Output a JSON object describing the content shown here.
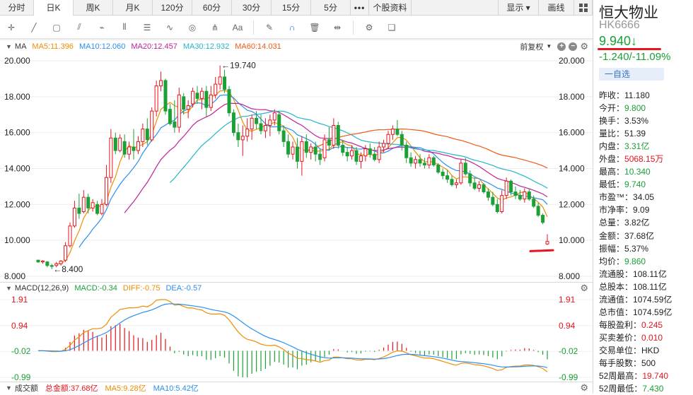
{
  "tabs": [
    {
      "label": "分时",
      "width": 48
    },
    {
      "label": "日K",
      "width": 56,
      "active": true
    },
    {
      "label": "周K",
      "width": 56
    },
    {
      "label": "月K",
      "width": 56
    },
    {
      "label": "120分",
      "width": 56
    },
    {
      "label": "60分",
      "width": 56
    },
    {
      "label": "30分",
      "width": 56
    },
    {
      "label": "15分",
      "width": 56
    },
    {
      "label": "5分",
      "width": 56
    },
    {
      "label": "•••",
      "width": 26,
      "dots": true
    },
    {
      "label": "个股资料",
      "width": 60
    }
  ],
  "tab_right": {
    "display": "显示",
    "draw": "画线"
  },
  "toolbar_icons": [
    "crosshair-icon",
    "line-icon",
    "rect-icon",
    "fan-icon",
    "path-icon",
    "parallel-icon",
    "fib-icon",
    "wave-icon",
    "circle-icon",
    "pitchfork-icon",
    "text-icon",
    "pen-icon",
    "magnet-icon",
    "trash-icon",
    "split-icon",
    "settings-icon",
    "layers-icon"
  ],
  "ma_bar": {
    "title": "MA",
    "items": [
      {
        "label": "MA5:11.396",
        "color": "#f08c00"
      },
      {
        "label": "MA10:12.060",
        "color": "#2a8ff0"
      },
      {
        "label": "MA20:12.457",
        "color": "#c0209b"
      },
      {
        "label": "MA30:12.932",
        "color": "#25b5c8"
      },
      {
        "label": "MA60:14.031",
        "color": "#f05a12"
      }
    ],
    "adjust": "前复权"
  },
  "macd_bar": {
    "title": "MACD(12,26,9)",
    "items": [
      {
        "label": "MACD:-0.34",
        "color": "#1aa035"
      },
      {
        "label": "DIFF:-0.75",
        "color": "#f08c00"
      },
      {
        "label": "DEA:-0.57",
        "color": "#2a8ff0"
      }
    ]
  },
  "vol_bar": {
    "title": "成交额",
    "items": [
      {
        "label": "总金额:37.68亿",
        "color": "#e8141e"
      },
      {
        "label": "MA5:9.28亿",
        "color": "#f08c00"
      },
      {
        "label": "MA10:5.42亿",
        "color": "#2a8ff0"
      }
    ]
  },
  "chart_data": {
    "type": "candlestick",
    "price_axis": {
      "ticks": [
        "20.000",
        "18.000",
        "16.000",
        "14.000",
        "12.000",
        "10.000",
        "8.000"
      ],
      "ylim": [
        8.0,
        20.0
      ]
    },
    "annotations": {
      "high": "←19.740",
      "low": "←8.400"
    },
    "macd_axis": {
      "ticks": [
        "1.91",
        "0.94",
        "-0.02",
        "-0.99"
      ],
      "tick_colors": [
        "#e8141e",
        "#e8141e",
        "#1aa035",
        "#1aa035"
      ],
      "ylim": [
        -0.99,
        1.91
      ]
    },
    "up_color": "#e8141e",
    "down_color": "#1aa035",
    "candles_ohlc": [
      [
        8.9,
        8.9,
        8.75,
        8.8
      ],
      [
        8.8,
        8.9,
        8.7,
        8.85
      ],
      [
        8.8,
        8.85,
        8.5,
        8.6
      ],
      [
        8.6,
        8.7,
        8.4,
        8.55
      ],
      [
        8.6,
        8.8,
        8.5,
        8.7
      ],
      [
        8.7,
        8.9,
        8.6,
        8.85
      ],
      [
        8.9,
        9.9,
        8.8,
        9.7
      ],
      [
        9.7,
        11.0,
        9.6,
        10.8
      ],
      [
        10.8,
        12.2,
        10.7,
        11.8
      ],
      [
        11.8,
        12.6,
        11.2,
        11.5
      ],
      [
        11.6,
        12.8,
        11.5,
        12.4
      ],
      [
        12.4,
        12.6,
        11.5,
        11.8
      ],
      [
        11.8,
        12.3,
        11.6,
        12.1
      ],
      [
        12.0,
        12.2,
        11.4,
        11.5
      ],
      [
        11.5,
        12.3,
        11.4,
        12.0
      ],
      [
        12.0,
        14.2,
        11.9,
        13.5
      ],
      [
        13.5,
        16.2,
        13.2,
        15.7
      ],
      [
        15.7,
        16.0,
        14.8,
        15.0
      ],
      [
        15.0,
        15.9,
        14.9,
        15.7
      ],
      [
        15.5,
        15.9,
        14.6,
        14.8
      ],
      [
        14.8,
        15.5,
        14.5,
        15.2
      ],
      [
        15.2,
        16.2,
        14.5,
        15.0
      ],
      [
        15.0,
        15.8,
        14.8,
        15.5
      ],
      [
        15.5,
        16.5,
        15.2,
        16.2
      ],
      [
        16.2,
        16.8,
        15.3,
        15.6
      ],
      [
        15.6,
        17.4,
        15.5,
        17.2
      ],
      [
        17.2,
        18.9,
        16.9,
        18.6
      ],
      [
        18.6,
        19.4,
        18.3,
        18.9
      ],
      [
        18.9,
        19.0,
        17.0,
        17.2
      ],
      [
        17.3,
        17.6,
        16.4,
        16.5
      ],
      [
        16.6,
        17.8,
        16.0,
        16.3
      ],
      [
        16.3,
        18.5,
        16.0,
        18.1
      ],
      [
        18.0,
        18.2,
        17.0,
        17.3
      ],
      [
        17.3,
        17.8,
        16.8,
        17.5
      ],
      [
        17.6,
        18.5,
        17.4,
        18.3
      ],
      [
        18.2,
        18.6,
        17.6,
        17.9
      ],
      [
        17.9,
        18.5,
        17.3,
        18.3
      ],
      [
        18.3,
        18.6,
        16.9,
        17.4
      ],
      [
        17.4,
        18.6,
        17.2,
        18.1
      ],
      [
        18.1,
        19.1,
        17.9,
        18.7
      ],
      [
        18.7,
        19.74,
        18.4,
        19.1
      ],
      [
        19.1,
        19.5,
        18.2,
        18.4
      ],
      [
        18.4,
        18.6,
        16.9,
        17.1
      ],
      [
        17.1,
        17.3,
        15.8,
        16.0
      ],
      [
        16.0,
        16.5,
        15.2,
        15.6
      ],
      [
        15.6,
        16.4,
        14.7,
        15.8
      ],
      [
        15.8,
        16.8,
        15.5,
        16.2
      ],
      [
        16.2,
        17.0,
        15.6,
        16.8
      ],
      [
        16.8,
        17.2,
        16.2,
        16.5
      ],
      [
        16.5,
        17.0,
        15.9,
        16.1
      ],
      [
        16.1,
        16.8,
        15.7,
        16.4
      ],
      [
        16.4,
        17.0,
        15.8,
        16.7
      ],
      [
        16.7,
        17.3,
        16.4,
        17.1
      ],
      [
        17.0,
        17.2,
        15.9,
        16.1
      ],
      [
        16.1,
        16.4,
        15.2,
        15.5
      ],
      [
        15.5,
        15.9,
        14.6,
        14.8
      ],
      [
        14.8,
        15.5,
        14.5,
        15.2
      ],
      [
        15.2,
        15.7,
        14.0,
        14.4
      ],
      [
        14.4,
        15.8,
        13.6,
        15.5
      ],
      [
        15.5,
        15.9,
        14.6,
        14.9
      ],
      [
        14.9,
        15.4,
        14.5,
        15.2
      ],
      [
        15.2,
        15.5,
        14.4,
        14.8
      ],
      [
        14.8,
        15.1,
        14.2,
        14.5
      ],
      [
        14.6,
        15.9,
        14.4,
        15.6
      ],
      [
        15.6,
        16.3,
        15.0,
        15.3
      ],
      [
        15.3,
        16.8,
        15.1,
        16.4
      ],
      [
        16.4,
        16.6,
        15.1,
        15.3
      ],
      [
        15.3,
        15.6,
        14.7,
        14.9
      ],
      [
        14.9,
        15.2,
        14.4,
        14.7
      ],
      [
        14.7,
        15.3,
        14.5,
        15.0
      ],
      [
        15.0,
        15.2,
        14.2,
        14.4
      ],
      [
        14.4,
        14.9,
        14.0,
        14.7
      ],
      [
        14.7,
        15.3,
        14.4,
        15.1
      ],
      [
        15.1,
        15.4,
        14.6,
        14.8
      ],
      [
        14.8,
        15.2,
        14.4,
        14.5
      ],
      [
        14.5,
        15.5,
        14.3,
        15.2
      ],
      [
        15.2,
        15.6,
        14.9,
        15.4
      ],
      [
        15.4,
        16.1,
        15.1,
        15.9
      ],
      [
        15.9,
        16.4,
        15.6,
        16.2
      ],
      [
        16.2,
        16.7,
        15.8,
        15.9
      ],
      [
        15.9,
        16.1,
        15.0,
        15.3
      ],
      [
        15.3,
        15.5,
        14.3,
        14.6
      ],
      [
        14.6,
        14.9,
        14.1,
        14.3
      ],
      [
        14.3,
        14.7,
        14.0,
        14.5
      ],
      [
        14.5,
        14.8,
        14.1,
        14.3
      ],
      [
        14.3,
        14.6,
        14.0,
        14.2
      ],
      [
        14.2,
        14.8,
        14.0,
        14.6
      ],
      [
        14.6,
        14.7,
        14.1,
        14.2
      ],
      [
        14.2,
        14.3,
        13.7,
        13.8
      ],
      [
        13.8,
        14.0,
        13.4,
        13.6
      ],
      [
        13.6,
        13.9,
        13.2,
        13.4
      ],
      [
        13.4,
        13.6,
        13.0,
        13.1
      ],
      [
        13.1,
        13.4,
        12.9,
        13.2
      ],
      [
        13.2,
        14.5,
        13.1,
        14.3
      ],
      [
        14.3,
        14.6,
        13.6,
        13.7
      ],
      [
        13.7,
        13.9,
        13.0,
        13.2
      ],
      [
        13.2,
        13.5,
        12.8,
        12.9
      ],
      [
        12.9,
        13.3,
        12.7,
        13.1
      ],
      [
        13.1,
        13.2,
        12.6,
        12.7
      ],
      [
        12.7,
        12.9,
        12.2,
        12.4
      ],
      [
        12.4,
        12.7,
        11.9,
        12.0
      ],
      [
        12.0,
        12.3,
        11.5,
        11.6
      ],
      [
        11.6,
        12.8,
        11.5,
        12.5
      ],
      [
        12.5,
        13.5,
        12.3,
        13.3
      ],
      [
        13.3,
        13.4,
        12.5,
        12.7
      ],
      [
        12.7,
        13.0,
        12.3,
        12.5
      ],
      [
        12.5,
        12.8,
        12.2,
        12.3
      ],
      [
        12.3,
        12.9,
        12.1,
        12.7
      ],
      [
        12.7,
        12.9,
        12.2,
        12.3
      ],
      [
        12.3,
        12.5,
        11.8,
        11.9
      ],
      [
        11.9,
        12.1,
        11.3,
        11.4
      ],
      [
        11.4,
        11.5,
        10.9,
        11.0
      ],
      [
        9.8,
        10.34,
        9.74,
        9.94
      ]
    ]
  },
  "stock": {
    "name": "恒大物业",
    "code": "HK6666",
    "price": "9.940↓",
    "change": "-1.240/-11.09%",
    "watch_label": "一自选"
  },
  "stats": [
    {
      "label": "昨收",
      "value": "11.180",
      "color": ""
    },
    {
      "label": "今开",
      "value": "9.800",
      "color": "green"
    },
    {
      "label": "换手",
      "value": "3.53%",
      "color": ""
    },
    {
      "label": "量比",
      "value": "51.39",
      "color": ""
    },
    {
      "label": "内盘",
      "value": "3.31亿",
      "color": "green"
    },
    {
      "label": "外盘",
      "value": "5068.15万",
      "color": "red"
    },
    {
      "label": "最高",
      "value": "10.340",
      "color": "green"
    },
    {
      "label": "最低",
      "value": "9.740",
      "color": "green"
    },
    {
      "label": "市盈™",
      "value": "34.05",
      "color": ""
    },
    {
      "label": "市净率",
      "value": "9.09",
      "color": ""
    },
    {
      "label": "总量",
      "value": "3.82亿",
      "color": ""
    },
    {
      "label": "金额",
      "value": "37.68亿",
      "color": ""
    },
    {
      "label": "振幅",
      "value": "5.37%",
      "color": ""
    },
    {
      "label": "均价",
      "value": "9.860",
      "color": "green"
    },
    {
      "label": "流通股",
      "value": "108.11亿",
      "color": ""
    },
    {
      "label": "总股本",
      "value": "108.11亿",
      "color": ""
    },
    {
      "label": "流通值",
      "value": "1074.59亿",
      "color": ""
    },
    {
      "label": "总市值",
      "value": "1074.59亿",
      "color": ""
    },
    {
      "label": "每股盈利",
      "value": "0.245",
      "color": "red"
    },
    {
      "label": "买卖差价",
      "value": "0.010",
      "color": "red"
    },
    {
      "label": "交易单位",
      "value": "HKD",
      "color": ""
    },
    {
      "label": "每手股数",
      "value": "500",
      "color": ""
    },
    {
      "label": "52周最高",
      "value": "19.740",
      "color": "red"
    },
    {
      "label": "52周最低",
      "value": "7.430",
      "color": "green"
    }
  ]
}
